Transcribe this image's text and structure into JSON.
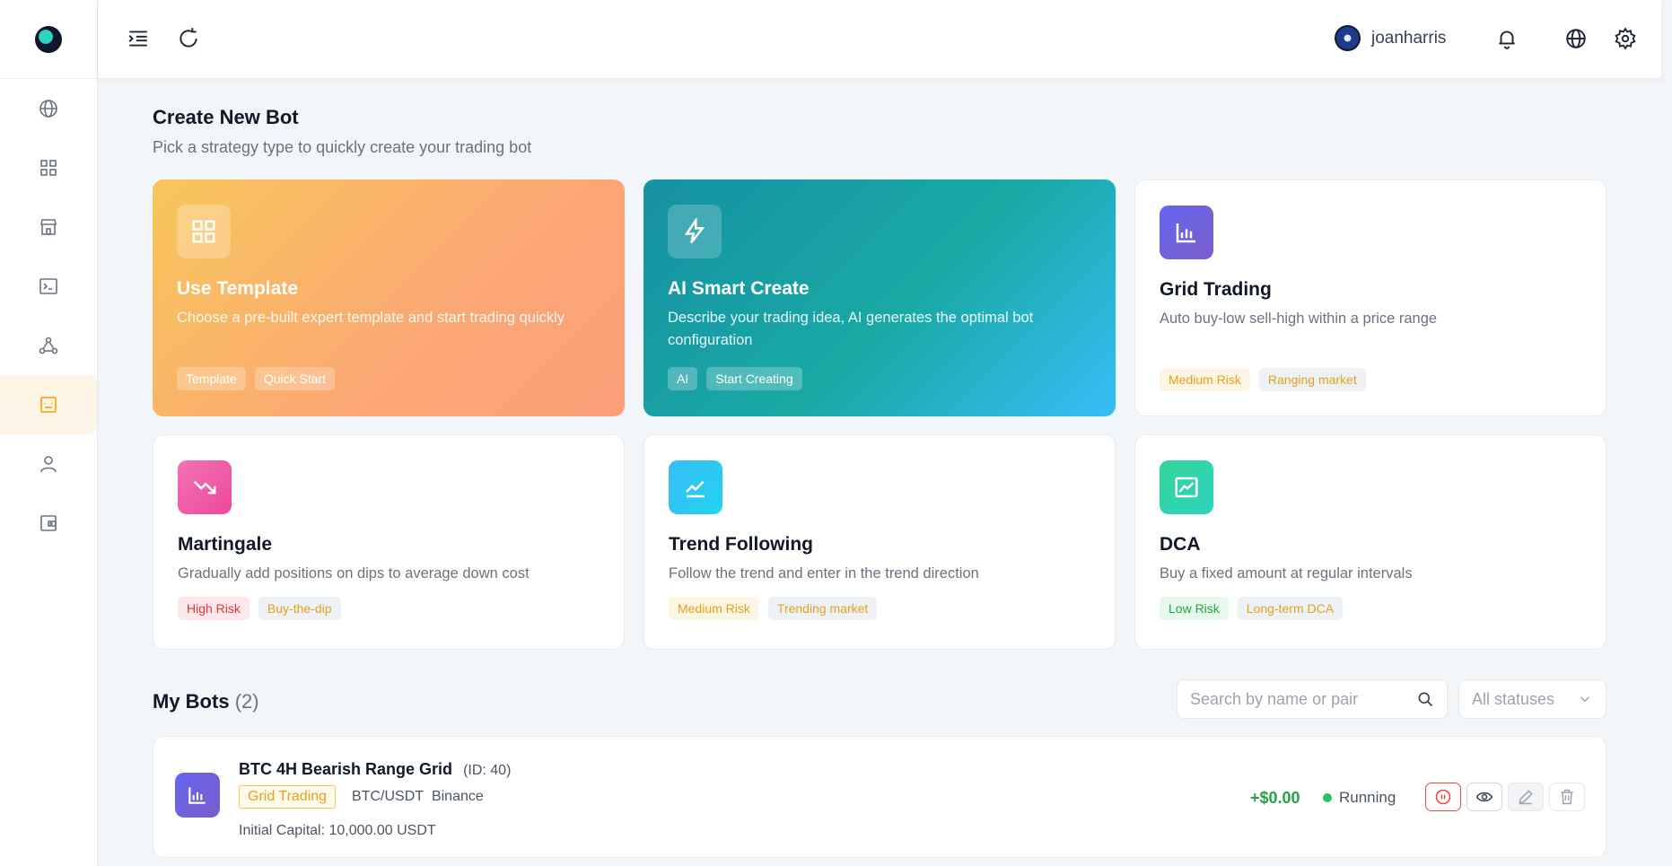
{
  "header": {
    "username": "joanharris"
  },
  "create": {
    "title": "Create New Bot",
    "subtitle": "Pick a strategy type to quickly create your trading bot"
  },
  "cards": [
    {
      "title": "Use Template",
      "desc": "Choose a pre-built expert template and start trading quickly",
      "tags": [
        "Template",
        "Quick Start"
      ],
      "icon": "grid-icon"
    },
    {
      "title": "AI Smart Create",
      "desc": "Describe your trading idea, AI generates the optimal bot configuration",
      "tags": [
        "AI",
        "Start Creating"
      ],
      "icon": "lightning-icon"
    },
    {
      "title": "Grid Trading",
      "desc": "Auto buy-low sell-high within a price range",
      "tags": [
        "Medium Risk",
        "Ranging market"
      ],
      "icon": "bar-chart-icon"
    },
    {
      "title": "Martingale",
      "desc": "Gradually add positions on dips to average down cost",
      "tags": [
        "High Risk",
        "Buy-the-dip"
      ],
      "icon": "trend-down-icon"
    },
    {
      "title": "Trend Following",
      "desc": "Follow the trend and enter in the trend direction",
      "tags": [
        "Medium Risk",
        "Trending market"
      ],
      "icon": "trend-up-icon"
    },
    {
      "title": "DCA",
      "desc": "Buy a fixed amount at regular intervals",
      "tags": [
        "Low Risk",
        "Long-term DCA"
      ],
      "icon": "line-chart-icon"
    }
  ],
  "bots": {
    "title": "My Bots",
    "count": "(2)",
    "search_placeholder": "Search by name or pair",
    "status_filter": "All statuses",
    "items": [
      {
        "name": "BTC 4H Bearish Range Grid",
        "id": "(ID: 40)",
        "type": "Grid Trading",
        "pair": "BTC/USDT",
        "exchange": "Binance",
        "capital": "Initial Capital: 10,000.00 USDT",
        "pnl": "+$0.00",
        "status": "Running"
      }
    ]
  },
  "colors": {
    "accent": "#f59e0b",
    "positive": "#22a447",
    "danger": "#ef4444"
  }
}
